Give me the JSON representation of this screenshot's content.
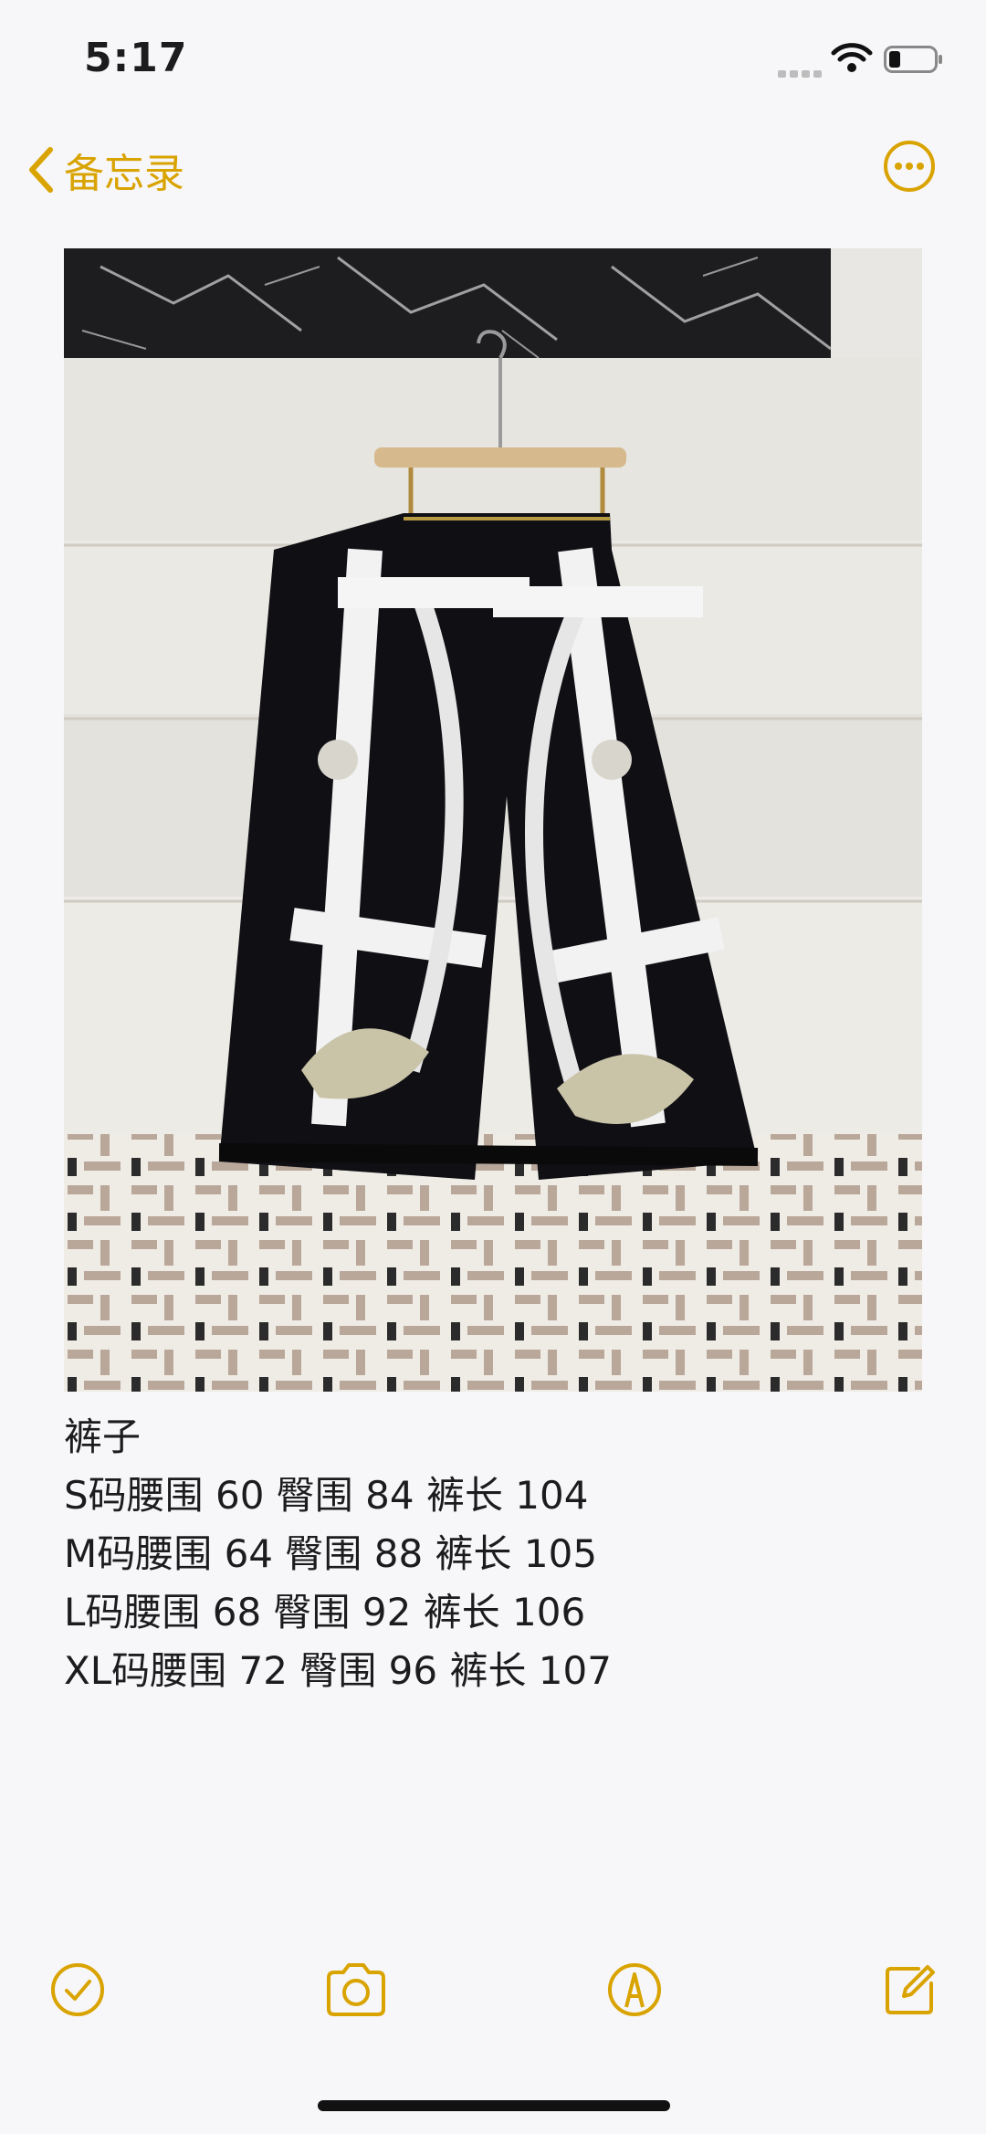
{
  "status_bar": {
    "time": "5:17"
  },
  "nav": {
    "back_label": "备忘录",
    "back_icon": "chevron-left-icon",
    "more_icon": "ellipsis-circle-icon"
  },
  "note": {
    "image": {
      "description_icon": "photo-wide-leg-printed-pants"
    },
    "lines": [
      "裤子",
      "S码腰围 60 臀围 84 裤长 104",
      "M码腰围 64 臀围 88 裤长 105",
      "L码腰围 68 臀围 92 裤长 106",
      "XL码腰围 72 臀围 96 裤长 107"
    ]
  },
  "toolbar": {
    "icons": [
      "checklist-icon",
      "camera-icon",
      "markup-pen-icon",
      "compose-icon"
    ]
  },
  "colors": {
    "accent": "#d9a300",
    "background": "#f7f6f8",
    "text": "#1c1c1e"
  }
}
